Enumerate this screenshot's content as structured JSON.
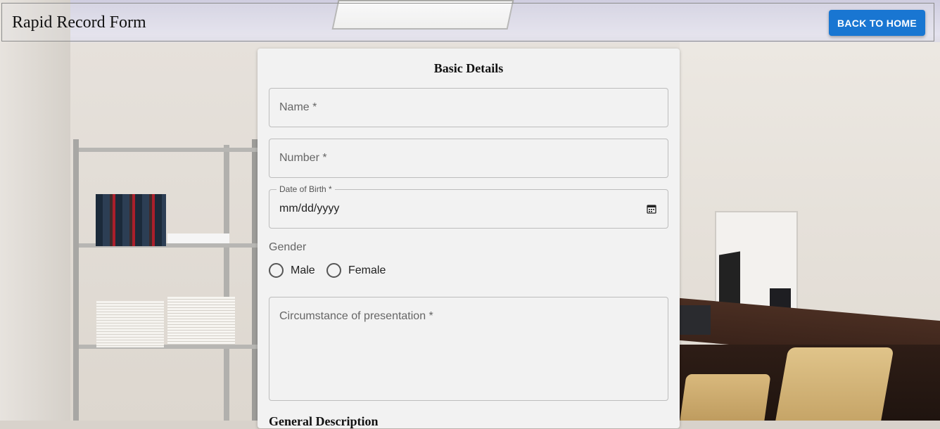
{
  "header": {
    "title": "Rapid Record Form",
    "back_button_label": "BACK TO HOME"
  },
  "form": {
    "section_title": "Basic Details",
    "name_placeholder": "Name *",
    "number_placeholder": "Number *",
    "dob_label": "Date of Birth *",
    "dob_value": "mm/dd/yyyy",
    "gender_label": "Gender",
    "gender_options": [
      "Male",
      "Female"
    ],
    "circumstance_placeholder": "Circumstance of presentation *",
    "next_section_title": "General Description"
  },
  "icons": {
    "calendar": "calendar-icon"
  },
  "colors": {
    "primary": "#1976d2",
    "card_bg": "#f2f2f2"
  }
}
